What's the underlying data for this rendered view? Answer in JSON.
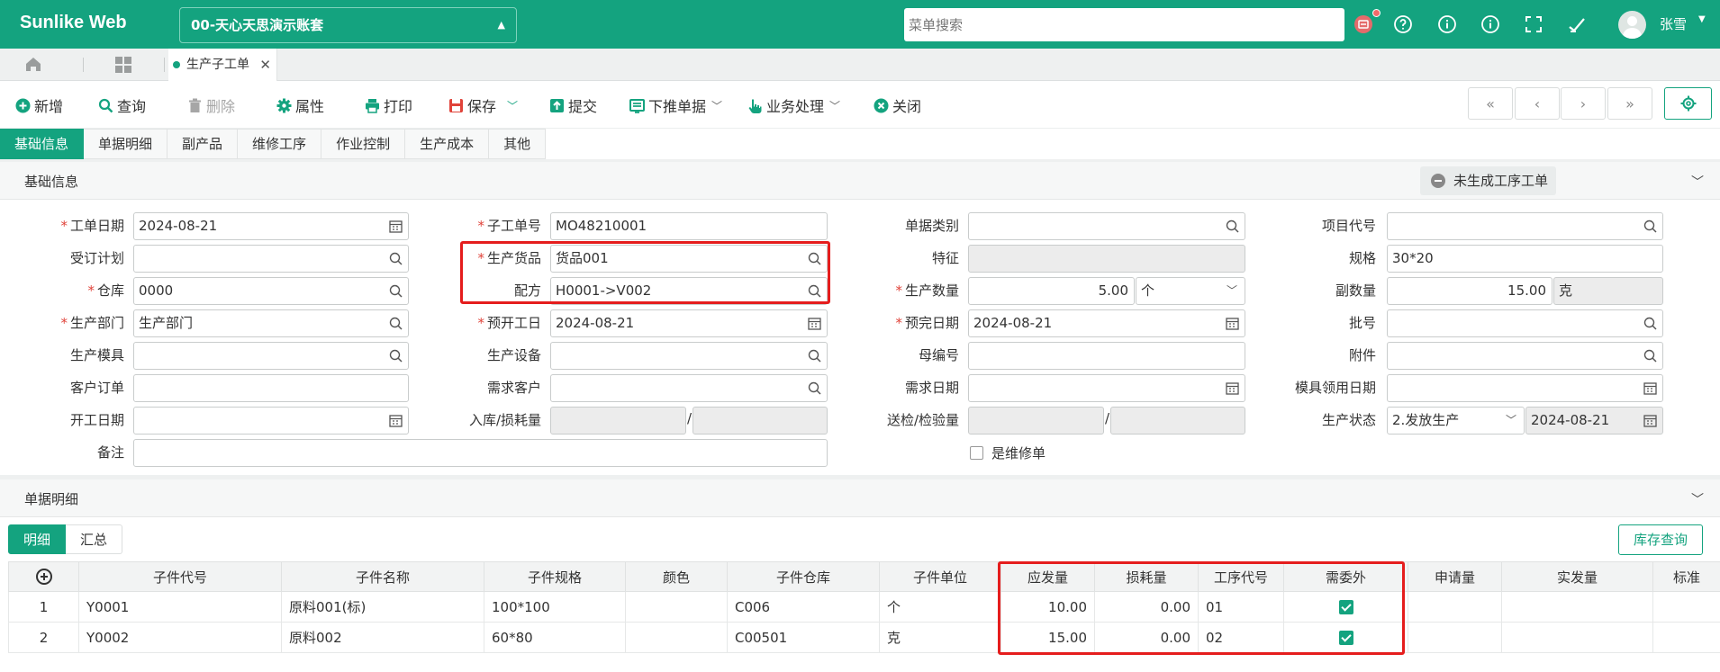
{
  "header": {
    "brand": "Sunlike Web",
    "company": "00-天心天思演示账套",
    "search_placeholder": "菜单搜索",
    "username": "张雪"
  },
  "tabs": {
    "active_tab": "生产子工单"
  },
  "toolbar": {
    "add": "新增",
    "query": "查询",
    "delete": "删除",
    "properties": "属性",
    "print": "打印",
    "save": "保存",
    "submit": "提交",
    "push_down": "下推单据",
    "business": "业务处理",
    "close": "关闭"
  },
  "section_tabs": [
    "基础信息",
    "单据明细",
    "副产品",
    "维修工序",
    "作业控制",
    "生产成本",
    "其他"
  ],
  "basic_info": {
    "title": "基础信息",
    "status": "未生成工序工单"
  },
  "form": {
    "work_order_date": {
      "label": "工单日期",
      "value": "2024-08-21"
    },
    "sub_order_no": {
      "label": "子工单号",
      "value": "MO48210001"
    },
    "doc_type": {
      "label": "单据类别",
      "value": ""
    },
    "project_code": {
      "label": "项目代号",
      "value": ""
    },
    "order_plan": {
      "label": "受订计划",
      "value": ""
    },
    "product": {
      "label": "生产货品",
      "value": "货品001"
    },
    "feature": {
      "label": "特征",
      "value": ""
    },
    "spec": {
      "label": "规格",
      "value": "30*20"
    },
    "warehouse": {
      "label": "仓库",
      "value": "0000"
    },
    "recipe": {
      "label": "配方",
      "value": "H0001->V002"
    },
    "quantity": {
      "label": "生产数量",
      "value": "5.00",
      "unit": "个"
    },
    "sub_quantity": {
      "label": "副数量",
      "value": "15.00",
      "unit": "克"
    },
    "department": {
      "label": "生产部门",
      "value": "生产部门"
    },
    "planned_start": {
      "label": "预开工日",
      "value": "2024-08-21"
    },
    "planned_finish": {
      "label": "预完日期",
      "value": "2024-08-21"
    },
    "batch_no": {
      "label": "批号",
      "value": ""
    },
    "mold": {
      "label": "生产模具",
      "value": ""
    },
    "equipment": {
      "label": "生产设备",
      "value": ""
    },
    "parent_no": {
      "label": "母编号",
      "value": ""
    },
    "attachment": {
      "label": "附件",
      "value": ""
    },
    "customer_order": {
      "label": "客户订单",
      "value": ""
    },
    "demand_customer": {
      "label": "需求客户",
      "value": ""
    },
    "demand_date": {
      "label": "需求日期",
      "value": ""
    },
    "mold_use_date": {
      "label": "模具领用日期",
      "value": ""
    },
    "start_date": {
      "label": "开工日期",
      "value": ""
    },
    "stock_loss": {
      "label": "入库/损耗量",
      "value1": "",
      "value2": ""
    },
    "inspection": {
      "label": "送检/检验量",
      "value1": "",
      "value2": ""
    },
    "production_status": {
      "label": "生产状态",
      "value": "2.发放生产",
      "date": "2024-08-21"
    },
    "remark": {
      "label": "备注",
      "value": ""
    },
    "is_repair": {
      "label": "是维修单",
      "checked": false
    }
  },
  "details": {
    "title": "单据明细",
    "subtabs": [
      "明细",
      "汇总"
    ],
    "stock_query": "库存查询",
    "columns": [
      "子件代号",
      "子件名称",
      "子件规格",
      "颜色",
      "子件仓库",
      "子件单位",
      "应发量",
      "损耗量",
      "工序代号",
      "需委外",
      "申请量",
      "实发量",
      "标准"
    ],
    "rows": [
      {
        "no": "1",
        "code": "Y0001",
        "name": "原料001(标)",
        "spec": "100*100",
        "color": "",
        "warehouse": "C006",
        "unit": "个",
        "issue_qty": "10.00",
        "loss_qty": "0.00",
        "process": "01",
        "outsource": true,
        "apply_qty": "",
        "actual_qty": ""
      },
      {
        "no": "2",
        "code": "Y0002",
        "name": "原料002",
        "spec": "60*80",
        "color": "",
        "warehouse": "C00501",
        "unit": "克",
        "issue_qty": "15.00",
        "loss_qty": "0.00",
        "process": "02",
        "outsource": true,
        "apply_qty": "",
        "actual_qty": ""
      }
    ]
  },
  "colors": {
    "brand": "#14a37f",
    "highlight": "#e51d1d"
  }
}
